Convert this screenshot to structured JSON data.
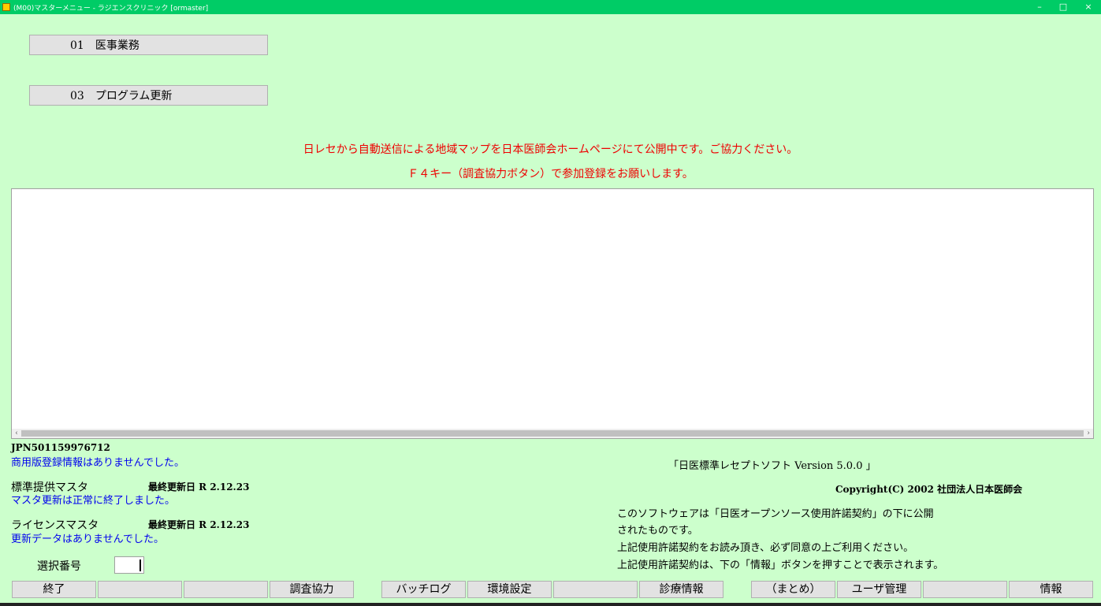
{
  "window": {
    "title": "(M00)マスターメニュー - ラジエンスクリニック [ormaster]",
    "minimize": "–",
    "maximize": "□",
    "close": "×"
  },
  "menu": {
    "item1": "01　医事業務",
    "item2": "03　プログラム更新"
  },
  "notice": {
    "line1": "日レセから自動送信による地域マップを日本医師会ホームページにて公開中です。ご協力ください。",
    "line2": "Ｆ４キー（調査協力ボタン）で参加登録をお願いします。"
  },
  "status": {
    "jpn_id": "JPN501159976712",
    "commercial_msg": "商用版登録情報はありませんでした。",
    "standard_master_label": "標準提供マスタ",
    "standard_master_date": "最終更新日 R 2.12.23",
    "standard_master_msg": "マスタ更新は正常に終了しました。",
    "license_master_label": "ライセンスマスタ",
    "license_master_date": "最終更新日 R 2.12.23",
    "license_master_msg": "更新データはありませんでした。"
  },
  "about": {
    "version": "「日医標準レセプトソフト Version 5.0.0 」",
    "copyright": "Copyright(C) 2002 社団法人日本医師会",
    "license1": "このソフトウェアは「日医オープンソース使用許諾契約」の下に公開",
    "license2": "されたものです。",
    "license3": "上記使用許諾契約をお読み頂き、必ず同意の上ご利用ください。",
    "license4": "上記使用許諾契約は、下の「情報」ボタンを押すことで表示されます。"
  },
  "select": {
    "label": "選択番号",
    "value": ""
  },
  "fkeys": [
    "終了",
    "",
    "",
    "調査協力",
    "バッチログ",
    "環境設定",
    "",
    "診療情報",
    "（まとめ）",
    "ユーザ管理",
    "",
    "情報"
  ]
}
